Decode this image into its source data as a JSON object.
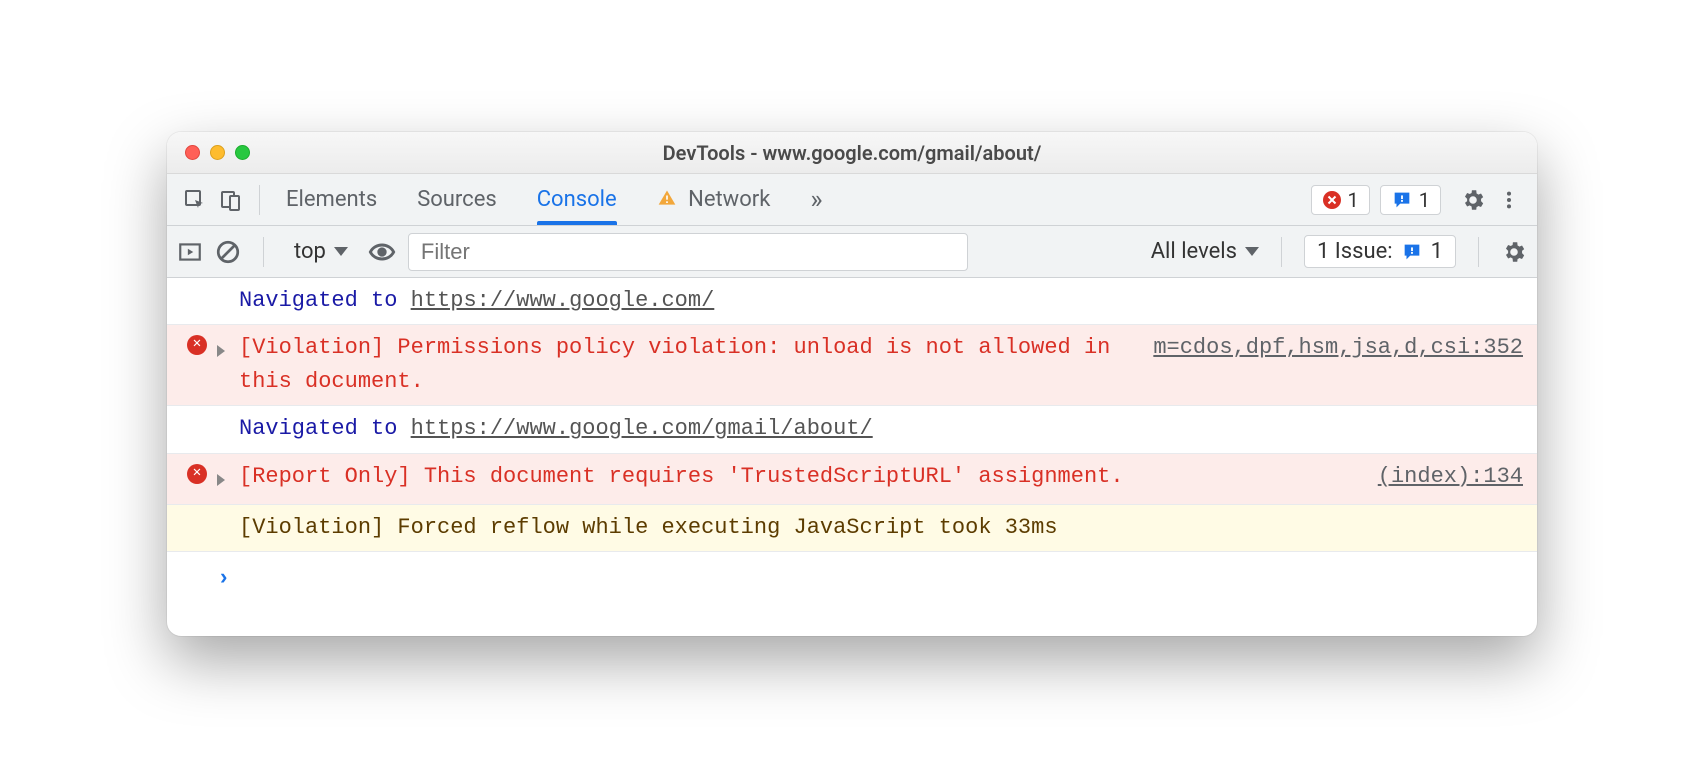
{
  "window": {
    "title": "DevTools - www.google.com/gmail/about/"
  },
  "tabs": {
    "elements": "Elements",
    "sources": "Sources",
    "console": "Console",
    "network": "Network",
    "more": "»"
  },
  "counts": {
    "errors": "1",
    "issues": "1"
  },
  "console_toolbar": {
    "context": "top",
    "filter_placeholder": "Filter",
    "levels": "All levels",
    "issues_label": "1 Issue:",
    "issues_count": "1"
  },
  "log": {
    "nav1_prefix": "Navigated to ",
    "nav1_url": "https://www.google.com/",
    "err1_text": "[Violation] Permissions policy violation: unload is not allowed in this document.",
    "err1_source": "m=cdos,dpf,hsm,jsa,d,csi:352",
    "nav2_prefix": "Navigated to ",
    "nav2_url": "https://www.google.com/gmail/about/",
    "err2_text": "[Report Only] This document requires 'TrustedScriptURL' assignment.",
    "err2_source": "(index):134",
    "warn1_text": "[Violation] Forced reflow while executing JavaScript took 33ms"
  }
}
